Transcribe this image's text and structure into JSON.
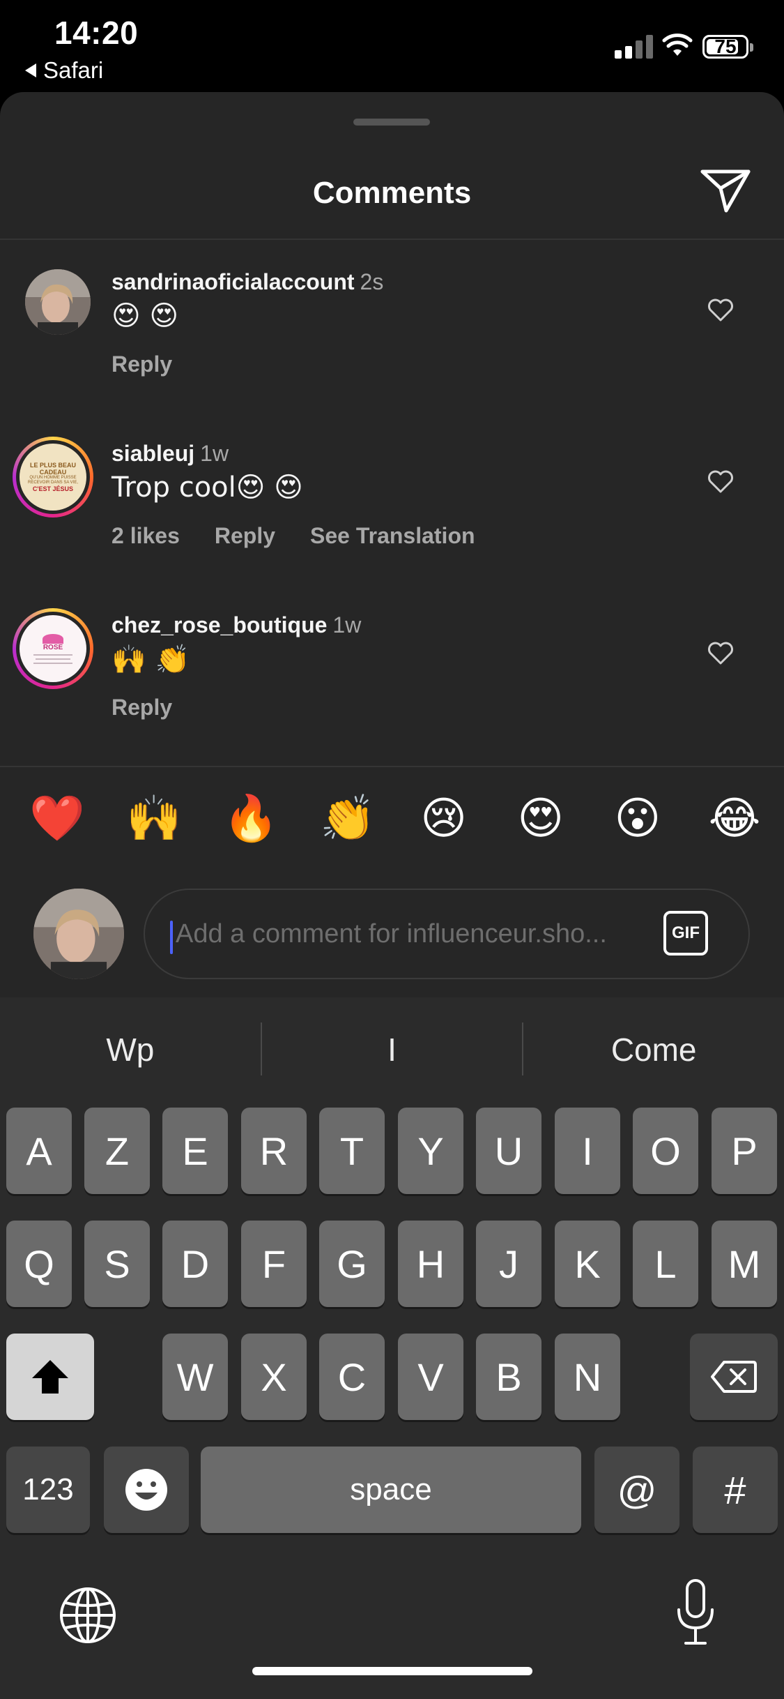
{
  "status_bar": {
    "time": "14:20",
    "back_app": "Safari",
    "battery": "75"
  },
  "sheet": {
    "title": "Comments",
    "share_icon": "paper-plane-icon"
  },
  "comments": [
    {
      "user": "sandrinaoficialaccount",
      "time": "2s",
      "text": "😍 😍",
      "actions": [
        "Reply"
      ]
    },
    {
      "user": "siableuj",
      "time": "1w",
      "text": "Trop cool😍 😍",
      "actions": [
        "2 likes",
        "Reply",
        "See Translation"
      ],
      "avatar_text": [
        "LE PLUS BEAU CADEAU",
        "QU'UN HOMME PUISSE RECEVOIR DANS SA VIE,",
        "C'EST JÉSUS"
      ]
    },
    {
      "user": "chez_rose_boutique",
      "time": "1w",
      "text": "🙌 👏",
      "actions": [
        "Reply"
      ],
      "avatar_text": [
        "ROSE"
      ]
    }
  ],
  "reactions": [
    "❤️",
    "🙌",
    "🔥",
    "👏",
    "😢",
    "😍",
    "😮",
    "😂"
  ],
  "composer": {
    "placeholder": "Add a comment for influenceur.sho...",
    "gif_label": "GIF"
  },
  "keyboard": {
    "predictions": [
      "Wp",
      "I",
      "Come"
    ],
    "row1": [
      "A",
      "Z",
      "E",
      "R",
      "T",
      "Y",
      "U",
      "I",
      "O",
      "P"
    ],
    "row2": [
      "Q",
      "S",
      "D",
      "F",
      "G",
      "H",
      "J",
      "K",
      "L",
      "M"
    ],
    "row3": [
      "W",
      "X",
      "C",
      "V",
      "B",
      "N"
    ],
    "numbers_key": "123",
    "space_key": "space",
    "at_key": "@",
    "hash_key": "#"
  }
}
